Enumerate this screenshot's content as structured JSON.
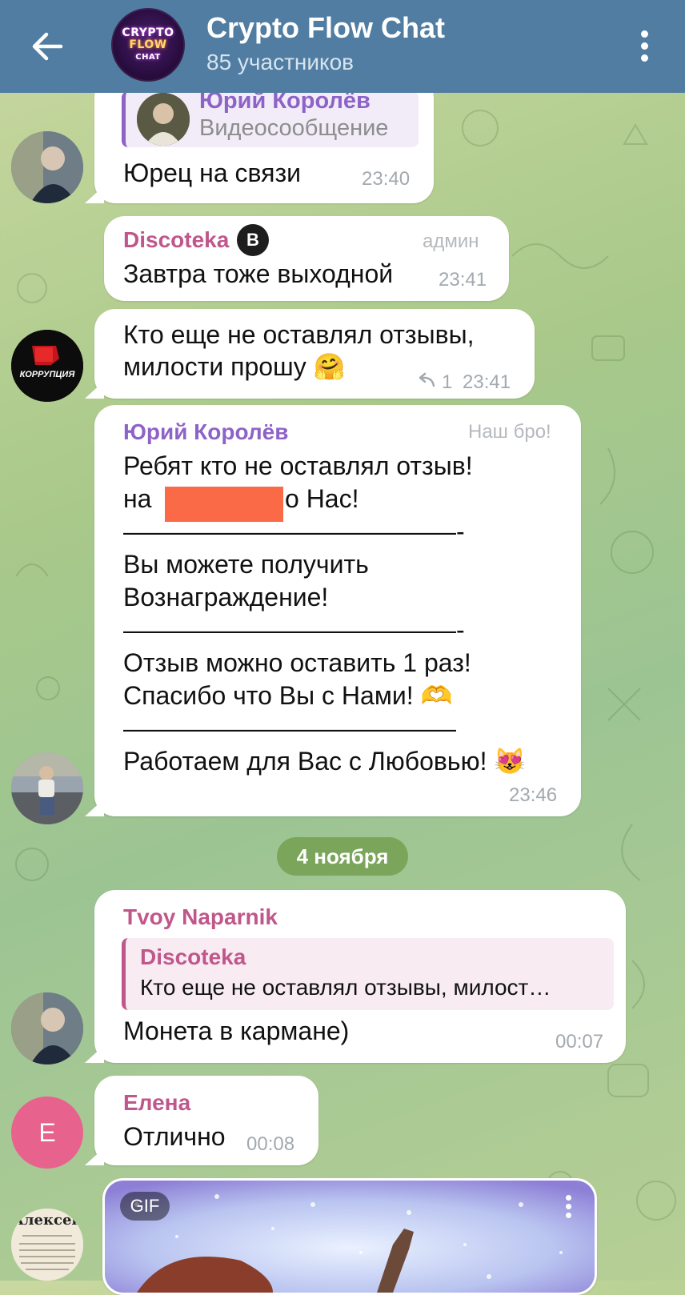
{
  "header": {
    "title": "Crypto Flow Chat",
    "subtitle": "85 участников",
    "avatar_lines": [
      "CRYPTO",
      "FLOW",
      "CHAT"
    ]
  },
  "messages": [
    {
      "id": "m1",
      "reply_sender": "Юрий Королёв",
      "reply_text": "Видеосообщение",
      "text": "Юрец на связи",
      "time": "23:40"
    },
    {
      "id": "m2",
      "sender": "Discoteka",
      "badge_letter": "B",
      "role": "админ",
      "text": "Завтра тоже выходной",
      "time": "23:41"
    },
    {
      "id": "m3",
      "lines": [
        "Кто еще не оставлял отзывы,",
        "милости прошу 🤗"
      ],
      "reply_count": "1",
      "time": "23:41",
      "avatar_text": "КОРРУПЦИЯ"
    },
    {
      "id": "m4",
      "sender": "Юрий Королёв",
      "role": "Наш бро!",
      "lines": [
        "Ребят кто не оставлял отзыв!",
        "на",
        "о Нас!",
        "—————————————-",
        "Вы можете получить",
        "Вознаграждение!",
        "—————————————-",
        "Отзыв можно оставить 1 раз!",
        "Спасибо что Вы с Нами! 🫶",
        "—————————————",
        "Работаем для Вас с Любовью! 😻"
      ],
      "time": "23:46"
    },
    {
      "id": "m5",
      "sender": "Tvoy Naparnik",
      "reply_sender": "Discoteka",
      "reply_text": "Кто еще не оставлял отзывы, милост…",
      "text": "Монета в кармане)",
      "time": "00:07"
    },
    {
      "id": "m6",
      "sender": "Елена",
      "avatar_letter": "Е",
      "text": "Отлично",
      "time": "00:08"
    },
    {
      "id": "m7",
      "media_badge": "GIF",
      "avatar_text": "Алексей"
    }
  ],
  "date_separator": "4 ноября",
  "colors": {
    "header_bg": "#517da2",
    "discoteka_name": "#c0578b",
    "yuri_name": "#8e63c7",
    "date_pill": "#7aa55a",
    "elena_avatar": "#e8628e"
  }
}
